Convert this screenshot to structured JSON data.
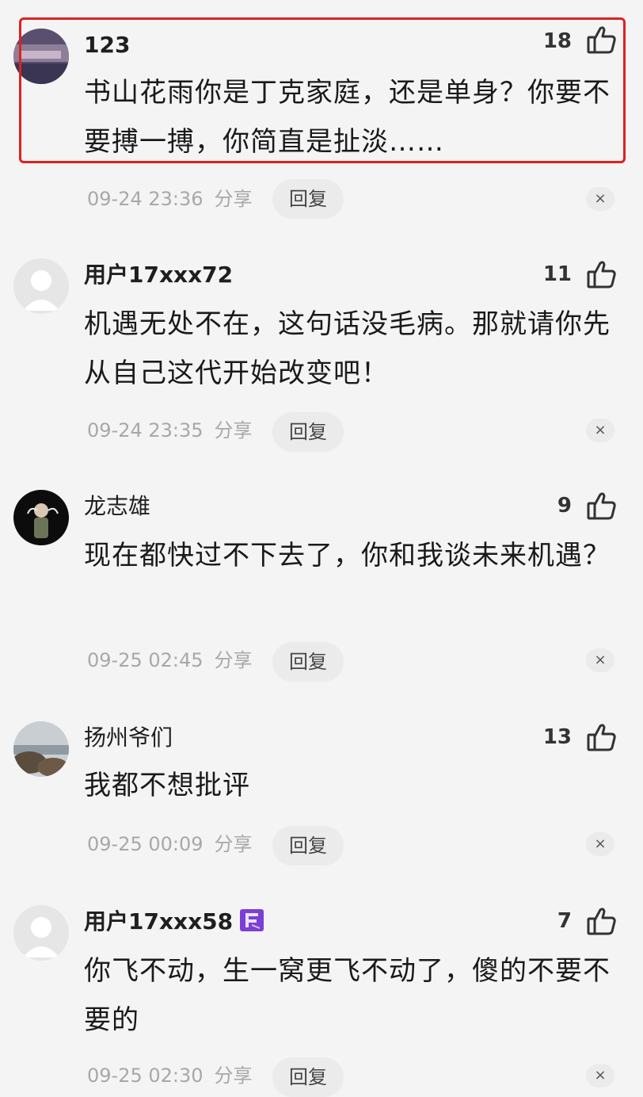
{
  "comments": [
    {
      "username": "123",
      "likes": "18",
      "text": "书山花雨你是丁克家庭，还是单身？你要不要搏一搏，你简直是扯淡……",
      "time": "09-24 23:36",
      "share": "分享",
      "reply": "回复",
      "close": "×",
      "highlighted": true
    },
    {
      "username": "用户17xxx72",
      "likes": "11",
      "text": "机遇无处不在，这句话没毛病。那就请你先从自己这代开始改变吧！",
      "time": "09-24 23:35",
      "share": "分享",
      "reply": "回复",
      "close": "×"
    },
    {
      "username": "龙志雄",
      "likes": "9",
      "text": "现在都快过不下去了，你和我谈未来机遇？",
      "time": "09-25 02:45",
      "share": "分享",
      "reply": "回复",
      "close": "×"
    },
    {
      "username": "扬州爷们",
      "likes": "13",
      "text": "我都不想批评",
      "time": "09-25 00:09",
      "share": "分享",
      "reply": "回复",
      "close": "×"
    },
    {
      "username": "用户17xxx58",
      "likes": "7",
      "text": "你飞不动，生一窝更飞不动了，傻的不要不要的",
      "time": "09-25 02:30",
      "share": "分享",
      "reply": "回复",
      "close": "×"
    }
  ],
  "colors": {
    "highlight_border": "#e02020",
    "badge": "#7b3fd6"
  }
}
